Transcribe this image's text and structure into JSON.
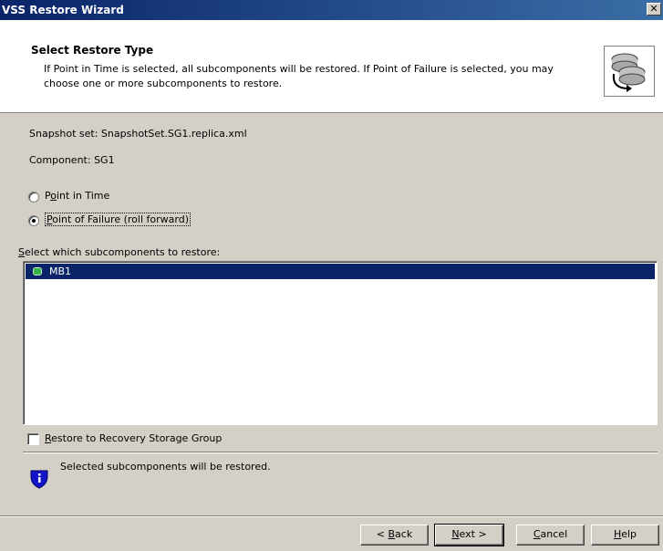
{
  "window": {
    "title": "VSS Restore Wizard",
    "close_glyph": "✕"
  },
  "header": {
    "title": "Select Restore Type",
    "description": "If Point in Time is selected, all subcomponents will be restored. If Point of Failure is selected, you may choose one or more subcomponents to restore.",
    "icon": "restore-disks-icon"
  },
  "info": {
    "snapshot_set": "Snapshot set: SnapshotSet.SG1.replica.xml",
    "component": "Component: SG1"
  },
  "restore_type": {
    "options": [
      {
        "pre": "P",
        "ul": "o",
        "post": "int in Time",
        "selected": false
      },
      {
        "pre": "",
        "ul": "P",
        "post": "oint of Failure (roll forward)",
        "selected": true
      }
    ]
  },
  "subcomponents": {
    "label_ul": "S",
    "label_rest": "elect which subcomponents to restore:",
    "items": [
      {
        "name": "MB1",
        "selected": true,
        "icon": "database-icon"
      }
    ]
  },
  "recovery": {
    "label_ul": "R",
    "label_rest": "estore to Recovery Storage Group",
    "checked": false
  },
  "status": {
    "message": "Selected subcomponents will be restored.",
    "icon": "info-shield-icon"
  },
  "buttons": {
    "back": {
      "pre": "< ",
      "ul": "B",
      "post": "ack"
    },
    "next": {
      "pre": "",
      "ul": "N",
      "post": "ext >"
    },
    "cancel": {
      "pre": "",
      "ul": "C",
      "post": "ancel"
    },
    "help": {
      "pre": "",
      "ul": "H",
      "post": "elp"
    }
  }
}
